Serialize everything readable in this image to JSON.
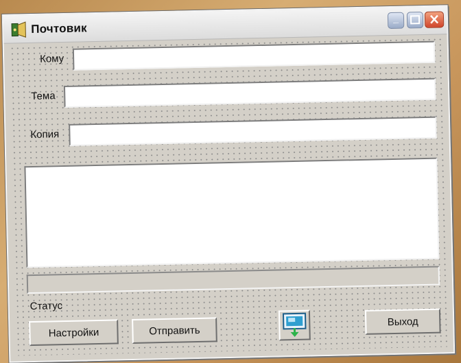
{
  "window": {
    "title": "Почтовик"
  },
  "form": {
    "to_label": "Кому",
    "to_value": "",
    "subject_label": "Тема",
    "subject_value": "",
    "copy_label": "Копия",
    "copy_value": "",
    "body_value": ""
  },
  "progress": {
    "value": 0
  },
  "status": {
    "label": "Статус"
  },
  "buttons": {
    "settings": "Настройки",
    "send": "Отправить",
    "exit": "Выход"
  },
  "icons": {
    "app": "mail-app-icon",
    "minimize": "minimize-icon",
    "maximize": "maximize-icon",
    "close": "close-icon",
    "receive": "computer-download-icon"
  },
  "colors": {
    "window_bg": "#d4d0c8",
    "close_button": "#d0452b",
    "caption_buttons": "#9aabc8",
    "icon_accent": "#2f9fd0",
    "download_arrow": "#2db34a"
  }
}
